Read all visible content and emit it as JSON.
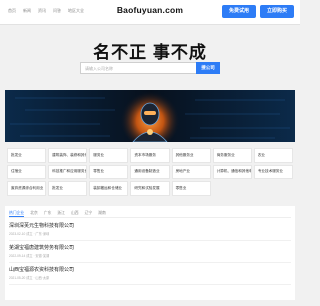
{
  "header": {
    "nav": [
      "首页",
      "新闻",
      "资讯",
      "问答",
      "地区大全"
    ],
    "site_title": "Baofuyuan.com",
    "try_button": "免费试用",
    "login_button": "立即购买"
  },
  "hero": {
    "heading": "名不正 事不成",
    "search_placeholder": "请输入公司名称",
    "search_button": "搜公司"
  },
  "categories": [
    "批发业",
    "建筑装饰、装修和其他建筑业",
    "服务业",
    "资本市场服务",
    "其他服务业",
    "商务服务业",
    "农业",
    "住宿业",
    "科技推广和应用服务业",
    "零售业",
    "通用设备制造业",
    "房地产业",
    "计算机、通信和其他电子设备制造业",
    "专业技术服务业",
    "废弃资源综合利用业",
    "批发业",
    "装卸搬运和仓储业",
    "研究和试验发展",
    "零售业"
  ],
  "list": {
    "tabs": [
      "热门企业",
      "北京",
      "广东",
      "浙江",
      "山西",
      "辽宁",
      "湖南"
    ],
    "active_tab": 0,
    "companies": [
      {
        "name": "深圳深芙元生物科技有限公司",
        "meta": "2023-02-10 成立 · 广东·深圳"
      },
      {
        "name": "芜湖宝福唐建筑劳务有限公司",
        "meta": "2022-09-14 成立 · 安徽·芜湖"
      },
      {
        "name": "山西宝福源农资科技有限公司",
        "meta": "2021-05-20 成立 · 山西·太原"
      },
      {
        "name": "",
        "meta": ""
      }
    ]
  },
  "colors": {
    "accent": "#2d7cf6",
    "banner_bg": "#0a1220"
  }
}
